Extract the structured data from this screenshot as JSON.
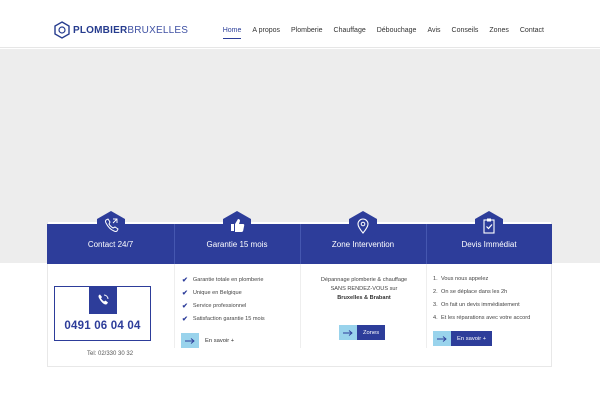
{
  "header": {
    "logo_part1": "PLOMBIER",
    "logo_part2": "BRUXELLES",
    "nav": [
      {
        "label": "Home",
        "active": true
      },
      {
        "label": "A propos"
      },
      {
        "label": "Plomberie"
      },
      {
        "label": "Chauffage"
      },
      {
        "label": "Débouchage"
      },
      {
        "label": "Avis"
      },
      {
        "label": "Conseils"
      },
      {
        "label": "Zones"
      },
      {
        "label": "Contact"
      }
    ]
  },
  "colors": {
    "brand_blue": "#2d3d9a",
    "light_blue": "#99d3ec",
    "hero_gray": "#ededed"
  },
  "cards": [
    {
      "title": "Contact 24/7",
      "icon": "phone-icon",
      "phone_number": "0491 06 04 04",
      "tel_line": "Tel: 02/330 30 32"
    },
    {
      "title": "Garantie 15 mois",
      "icon": "thumbs-up-icon",
      "items": [
        "Garantie totale en plomberie",
        "Unique en Belgique",
        "Service professionnel",
        "Satisfaction garantie 15 mois"
      ],
      "button_label": "En savoir +"
    },
    {
      "title": "Zone Intervention",
      "icon": "location-pin-icon",
      "line1": "Dépannage plomberie & chauffage",
      "line2": "SANS RENDEZ-VOUS sur",
      "line3": "Bruxelles & Brabant",
      "button_label": "Zones"
    },
    {
      "title": "Devis Immédiat",
      "icon": "clipboard-check-icon",
      "items": [
        "Vous nous appelez",
        "On se déplace dans les 2h",
        "On fait un devis immédiatement",
        "Et les réparations avec votre accord"
      ],
      "button_label": "En savoir +"
    }
  ]
}
